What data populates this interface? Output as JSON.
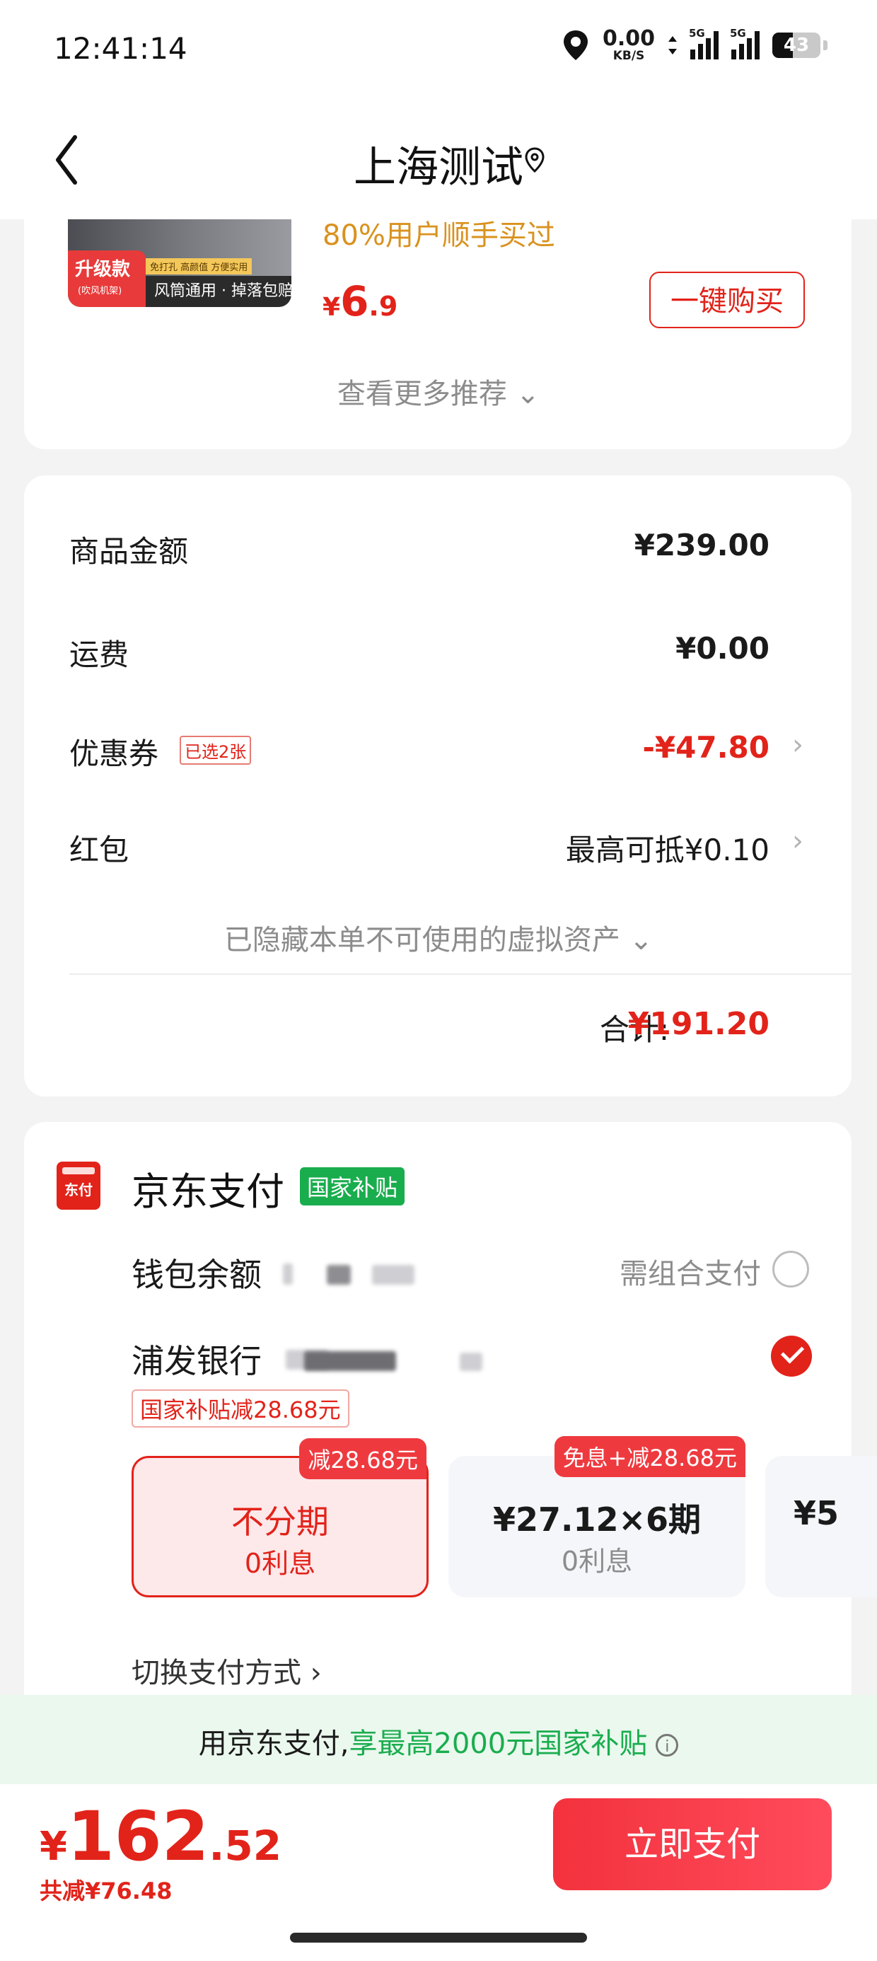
{
  "status_bar": {
    "time": "12:41:14",
    "net_speed": "0.00",
    "net_unit": "KB/S",
    "signal1_tag": "5G",
    "signal2_tag": "5G",
    "battery": "43",
    "battery_level": 0.43
  },
  "header": {
    "title": "上海测试"
  },
  "recommend": {
    "image_badge": "升级款",
    "image_badge_sub": "(吹风机架)",
    "image_tiny": "免打孔 高颜值 方便实用",
    "image_strip": "风筒通用 · 掉落包赔",
    "bought_text": "80%用户顺手买过",
    "price_currency": "¥",
    "price_int": "6",
    "price_dec": ".9",
    "buy_button": "一键购买",
    "more_text": "查看更多推荐 ⌄"
  },
  "summary": {
    "goods_label": "商品金额",
    "goods_value": "¥239.00",
    "shipping_label": "运费",
    "shipping_value": "¥0.00",
    "coupon_label": "优惠券",
    "coupon_tag": "已选2张",
    "coupon_value": "-¥47.80",
    "redpacket_label": "红包",
    "redpacket_value": "最高可抵¥0.10",
    "hidden_assets": "已隐藏本单不可使用的虚拟资产 ⌄",
    "total_label": "合计:",
    "total_value": "¥191.20"
  },
  "payment": {
    "logo_text": "东付",
    "title": "京东支付",
    "gov_badge": "国家补贴",
    "wallet_label": "钱包余额",
    "combo_text": "需组合支付",
    "bank_label": "浦发银行",
    "gov_discount": "国家补贴减28.68元",
    "plans": [
      {
        "tag": "减28.68元",
        "main": "不分期",
        "sub": "0利息"
      },
      {
        "tag": "免息+减28.68元",
        "main": "¥27.12×6期",
        "sub": "0利息"
      },
      {
        "main": "¥5"
      }
    ],
    "switch_text": "切换支付方式 ›"
  },
  "promo": {
    "prefix": "用京东支付,",
    "highlight": "享最高2000元国家补贴",
    "info_icon": "i"
  },
  "bottom": {
    "currency": "¥",
    "price_int": "162",
    "price_dec": ".52",
    "saved": "共减¥76.48",
    "pay_button": "立即支付"
  },
  "colors": {
    "accent_red": "#e2231a",
    "green": "#1aad4e",
    "orange": "#d9921f"
  }
}
